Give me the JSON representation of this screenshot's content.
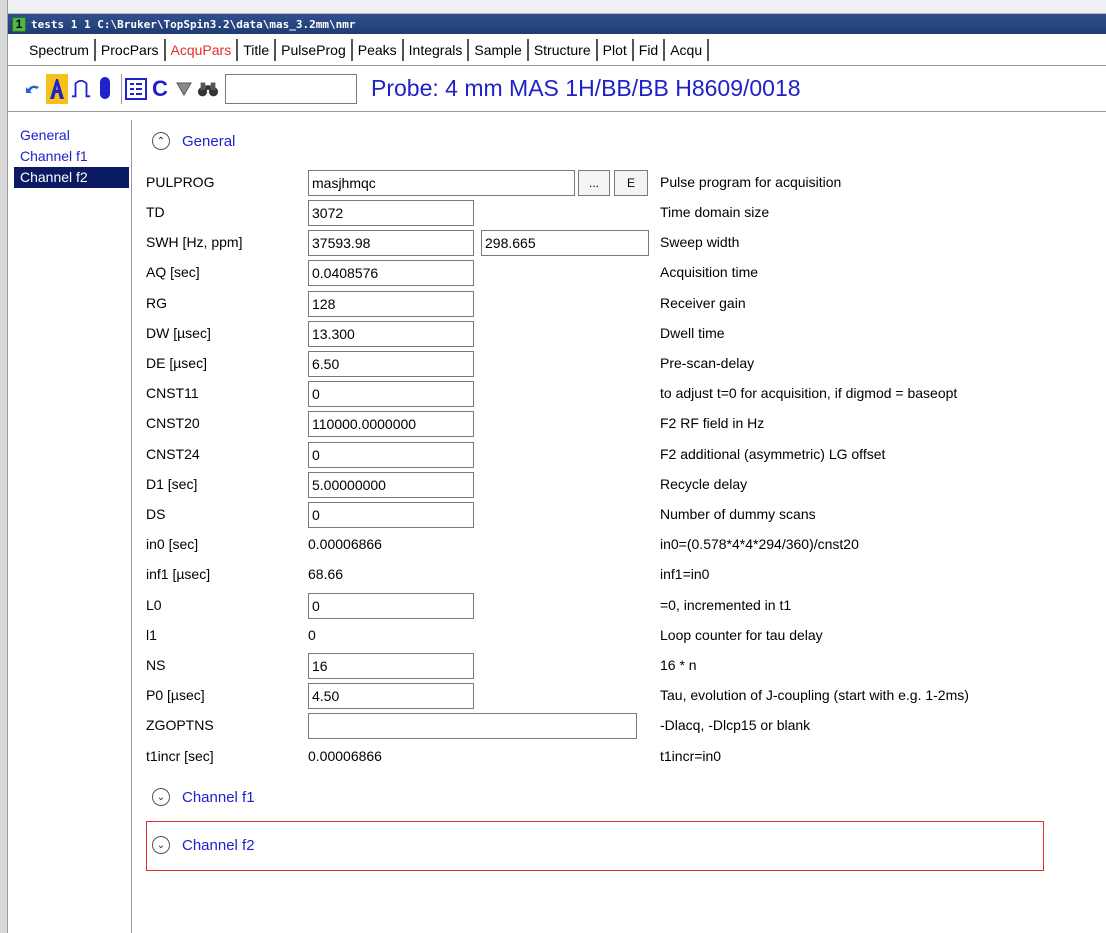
{
  "window": {
    "number": "1",
    "title": "tests 1 1 C:\\Bruker\\TopSpin3.2\\data\\mas_3.2mm\\nmr"
  },
  "tabs": [
    {
      "label": "Spectrum",
      "active": false
    },
    {
      "label": "ProcPars",
      "active": false
    },
    {
      "label": "AcquPars",
      "active": true
    },
    {
      "label": "Title",
      "active": false
    },
    {
      "label": "PulseProg",
      "active": false
    },
    {
      "label": "Peaks",
      "active": false
    },
    {
      "label": "Integrals",
      "active": false
    },
    {
      "label": "Sample",
      "active": false
    },
    {
      "label": "Structure",
      "active": false
    },
    {
      "label": "Plot",
      "active": false
    },
    {
      "label": "Fid",
      "active": false
    },
    {
      "label": "Acqu",
      "active": false
    }
  ],
  "toolbar": {
    "icons": [
      "undo-icon",
      "acquisition-mode-icon",
      "pulse-icon",
      "probe-tube-icon",
      "table-icon",
      "c-icon",
      "filter-icon",
      "binoculars-icon"
    ],
    "search_value": "",
    "probe": "Probe: 4 mm MAS 1H/BB/BB H8609/0018"
  },
  "sidebar": {
    "items": [
      {
        "label": "General",
        "selected": false
      },
      {
        "label": "Channel f1",
        "selected": false
      },
      {
        "label": "Channel f2",
        "selected": true
      }
    ]
  },
  "sections": {
    "general": "General",
    "channel_f1": "Channel f1",
    "channel_f2": "Channel f2"
  },
  "pulprog": {
    "label": "PULPROG",
    "value": "masjhmqc",
    "browse_label": "...",
    "edit_label": "E",
    "desc": "Pulse program for acquisition"
  },
  "params": [
    {
      "label": "TD",
      "value": "3072",
      "desc": "Time domain size",
      "kind": "field"
    },
    {
      "label": "SWH [Hz, ppm]",
      "value": "37593.98",
      "value2": "298.665",
      "desc": "Sweep width",
      "kind": "double"
    },
    {
      "label": "AQ [sec]",
      "value": "0.0408576",
      "desc": "Acquisition time",
      "kind": "field"
    },
    {
      "label": "RG",
      "value": "128",
      "desc": "Receiver gain",
      "kind": "field"
    },
    {
      "label": "DW [µsec]",
      "value": "13.300",
      "desc": "Dwell time",
      "kind": "field"
    },
    {
      "label": "DE [µsec]",
      "value": "6.50",
      "desc": "Pre-scan-delay",
      "kind": "field"
    },
    {
      "label": "CNST11",
      "value": "0",
      "desc": "to adjust t=0 for acquisition, if digmod = baseopt",
      "kind": "field"
    },
    {
      "label": "CNST20",
      "value": "110000.0000000",
      "desc": "F2 RF field in Hz",
      "kind": "field"
    },
    {
      "label": "CNST24",
      "value": "0",
      "desc": "F2 additional (asymmetric) LG offset",
      "kind": "field"
    },
    {
      "label": "D1 [sec]",
      "value": "5.00000000",
      "desc": "Recycle delay",
      "kind": "field"
    },
    {
      "label": "DS",
      "value": "0",
      "desc": "Number of dummy scans",
      "kind": "field"
    },
    {
      "label": "in0 [sec]",
      "value": "0.00006866",
      "desc": "in0=(0.578*4*4*294/360)/cnst20",
      "kind": "static"
    },
    {
      "label": "inf1 [µsec]",
      "value": "68.66",
      "desc": "inf1=in0",
      "kind": "static"
    },
    {
      "label": "L0",
      "value": "0",
      "desc": "=0, incremented in t1",
      "kind": "field"
    },
    {
      "label": "l1",
      "value": "0",
      "desc": "Loop counter for tau delay",
      "kind": "static"
    },
    {
      "label": "NS",
      "value": "16",
      "desc": "16 * n",
      "kind": "field"
    },
    {
      "label": "P0 [µsec]",
      "value": "4.50",
      "desc": "Tau, evolution of J-coupling (start with e.g. 1-2ms)",
      "kind": "field"
    },
    {
      "label": "ZGOPTNS",
      "value": "",
      "desc": "-Dlacq, -Dlcp15 or blank",
      "kind": "wide"
    },
    {
      "label": "t1incr [sec]",
      "value": "0.00006866",
      "desc": "t1incr=in0",
      "kind": "static"
    }
  ]
}
